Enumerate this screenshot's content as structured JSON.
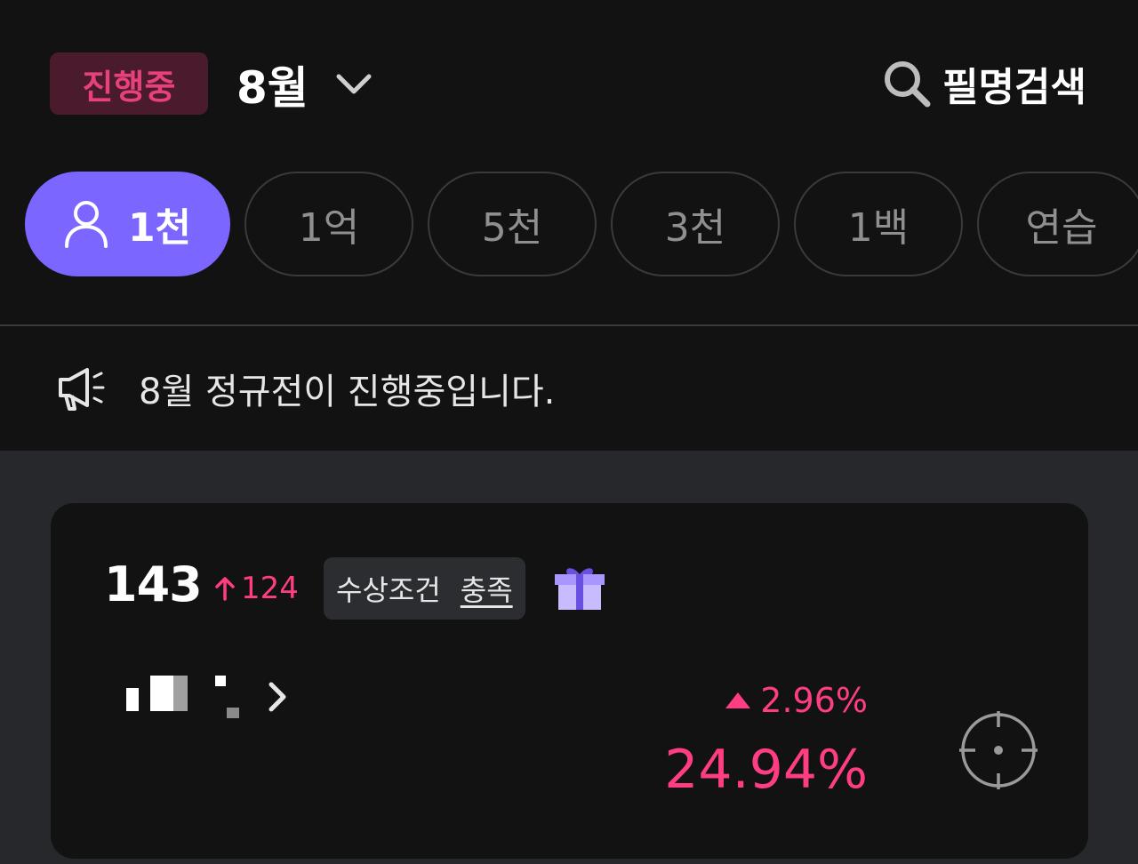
{
  "header": {
    "status_badge": "진행중",
    "month": "8월",
    "search_label": "필명검색",
    "icons": {
      "month_dropdown": "chevron-down-icon",
      "search": "search-icon"
    }
  },
  "tabs": [
    {
      "label": "1천",
      "active": true,
      "icon": "user-icon"
    },
    {
      "label": "1억",
      "active": false
    },
    {
      "label": "5천",
      "active": false
    },
    {
      "label": "3천",
      "active": false
    },
    {
      "label": "1백",
      "active": false
    },
    {
      "label": "연습",
      "active": false
    }
  ],
  "notice": {
    "icon": "megaphone-icon",
    "text": "8월 정규전이 진행중입니다."
  },
  "card": {
    "rank": "143",
    "rank_change": "124",
    "rank_change_direction": "up",
    "award_condition_label": "수상조건",
    "award_condition_status": "충족",
    "gift_icon": "gift-icon",
    "rate_change": "2.96%",
    "rate": "24.94%",
    "target_icon": "crosshair-icon"
  },
  "colors": {
    "background": "#121212",
    "accent": "#7b66ff",
    "positive": "#ff3d83",
    "badge_bg": "#4a1b2c",
    "content_bg": "#26282b"
  }
}
